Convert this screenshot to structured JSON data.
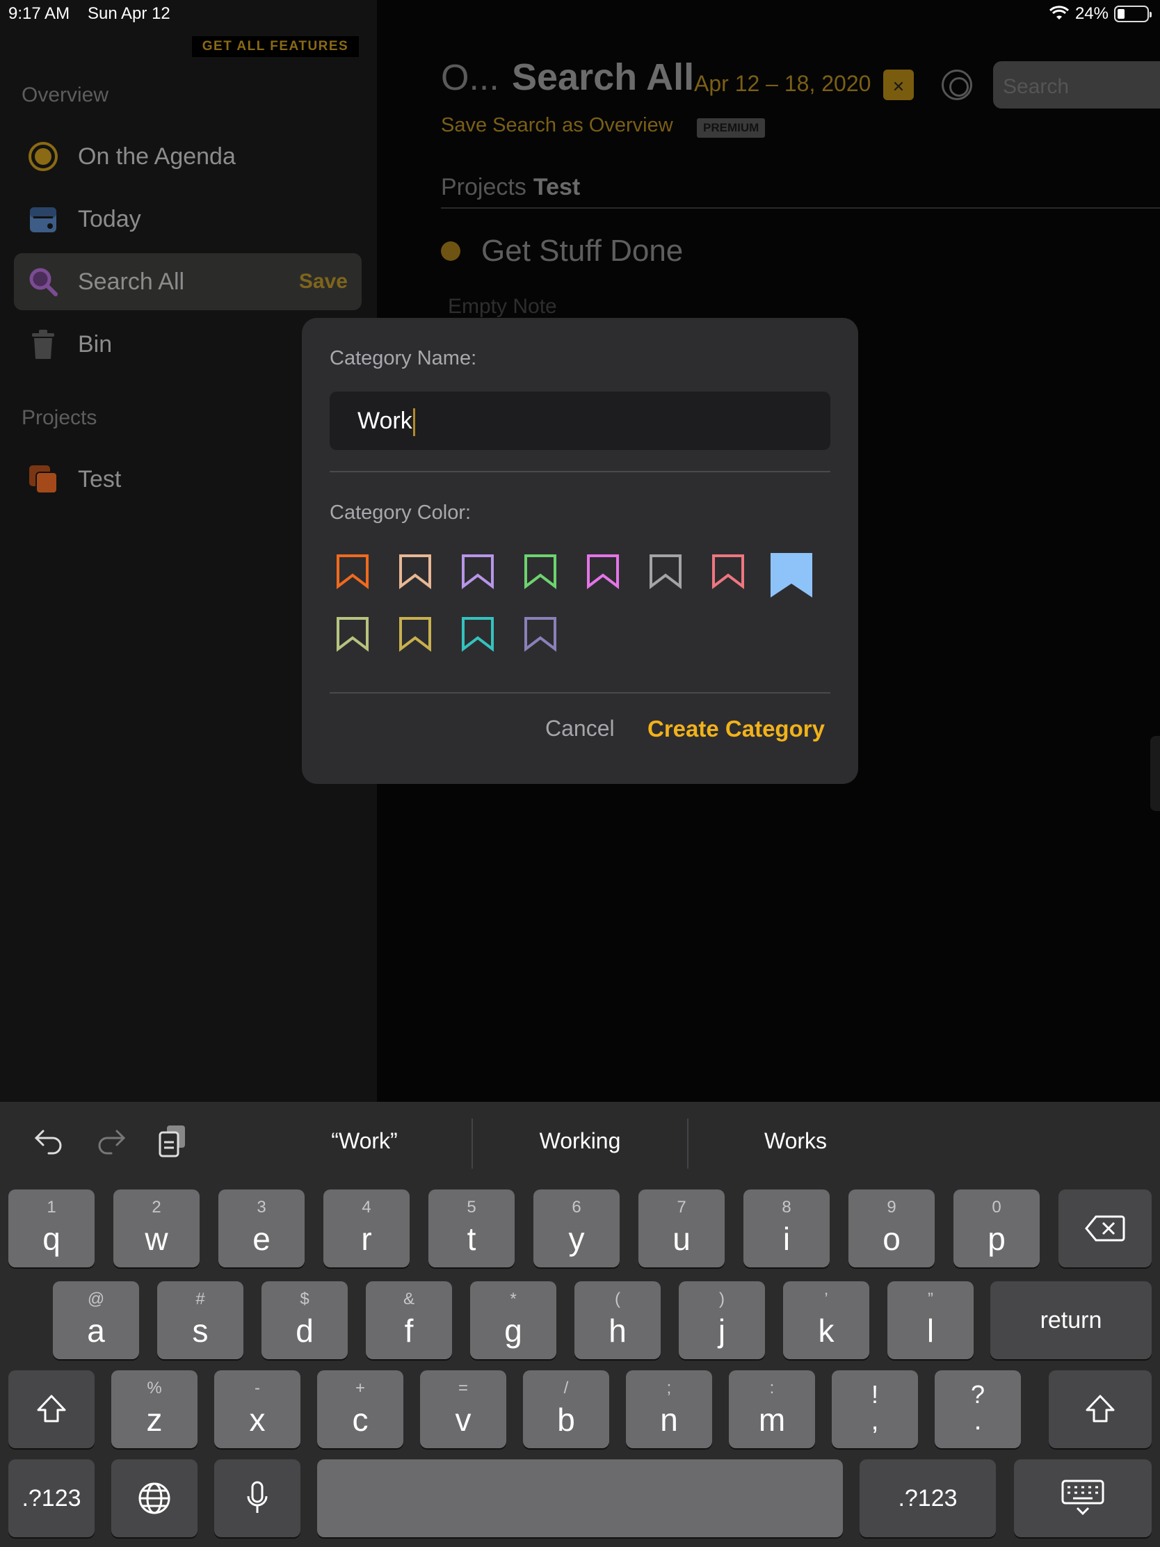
{
  "status_bar": {
    "time": "9:17 AM",
    "date": "Sun Apr 12",
    "battery": "24%"
  },
  "sidebar": {
    "promo": "GET ALL FEATURES",
    "overview_header": "Overview",
    "items": [
      {
        "label": "On the Agenda",
        "icon": "agenda-ring-icon"
      },
      {
        "label": "Today",
        "icon": "calendar-icon"
      },
      {
        "label": "Search All",
        "icon": "search-icon",
        "action": "Save"
      },
      {
        "label": "Bin",
        "icon": "trash-icon"
      }
    ],
    "projects_header": "Projects",
    "projects": [
      {
        "label": "Test",
        "icon": "project-stack-icon"
      }
    ]
  },
  "main": {
    "title_prefix": "O...",
    "title": "Search All",
    "date_range": "Apr 12 – 18, 2020",
    "save_search_link": "Save Search as Overview",
    "premium_badge": "PREMIUM",
    "search_placeholder": "Search",
    "breadcrumb": {
      "parent": "Projects",
      "current": "Test"
    },
    "entry_title": "Get Stuff Done",
    "entry_note_placeholder": "Empty Note"
  },
  "dialog": {
    "name_label": "Category Name:",
    "name_value": "Work",
    "color_label": "Category Color:",
    "colors": [
      "#f06a1e",
      "#e8b894",
      "#b895e8",
      "#6ed36e",
      "#e574e8",
      "#a4a4a8",
      "#ee7680",
      "#8ec3fa",
      "#b6c47e",
      "#c9b04e",
      "#35c2be",
      "#8b80b8"
    ],
    "selected_color": "#8ec3fa",
    "cancel_label": "Cancel",
    "confirm_label": "Create Category"
  },
  "keyboard": {
    "suggestions": [
      "“Work”",
      "Working",
      "Works"
    ],
    "row1": [
      {
        "k": "q",
        "s": "1"
      },
      {
        "k": "w",
        "s": "2"
      },
      {
        "k": "e",
        "s": "3"
      },
      {
        "k": "r",
        "s": "4"
      },
      {
        "k": "t",
        "s": "5"
      },
      {
        "k": "y",
        "s": "6"
      },
      {
        "k": "u",
        "s": "7"
      },
      {
        "k": "i",
        "s": "8"
      },
      {
        "k": "o",
        "s": "9"
      },
      {
        "k": "p",
        "s": "0"
      }
    ],
    "row2": [
      {
        "k": "a",
        "s": "@"
      },
      {
        "k": "s",
        "s": "#"
      },
      {
        "k": "d",
        "s": "$"
      },
      {
        "k": "f",
        "s": "&"
      },
      {
        "k": "g",
        "s": "*"
      },
      {
        "k": "h",
        "s": "("
      },
      {
        "k": "j",
        "s": ")"
      },
      {
        "k": "k",
        "s": "’"
      },
      {
        "k": "l",
        "s": "”"
      }
    ],
    "row3": [
      {
        "k": "z",
        "s": "%"
      },
      {
        "k": "x",
        "s": "-"
      },
      {
        "k": "c",
        "s": "+"
      },
      {
        "k": "v",
        "s": "="
      },
      {
        "k": "b",
        "s": "/"
      },
      {
        "k": "n",
        "s": ";"
      },
      {
        "k": "m",
        "s": ":"
      },
      {
        "k": ",",
        "s": "!"
      },
      {
        "k": ".",
        "s": "?"
      }
    ],
    "return_label": "return",
    "numbers_label": ".?123"
  }
}
